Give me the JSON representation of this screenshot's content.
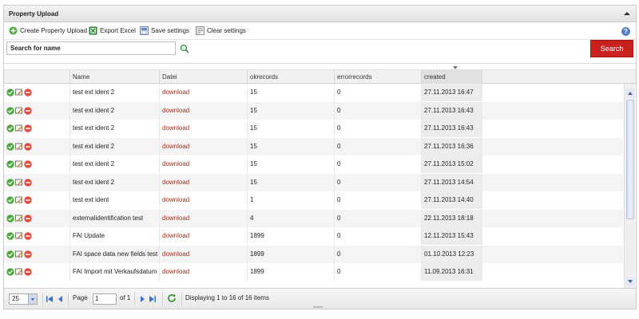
{
  "panel": {
    "title": "Property Upload"
  },
  "toolbar": {
    "create_label": "Create Property Upload",
    "export_label": "Export Excel",
    "save_label": "Save settings",
    "clear_label": "Clear settings"
  },
  "search": {
    "placeholder": "Search for name",
    "value": "Search for name",
    "button_label": "Search"
  },
  "columns": [
    "",
    "Name",
    "Datei",
    "okrecords",
    "errorrecords",
    "created"
  ],
  "rows": [
    {
      "name": "test ext ident 2",
      "file": "download",
      "ok": "15",
      "err": "0",
      "created": "27.11.2013 16:47"
    },
    {
      "name": "test ext ident 2",
      "file": "download",
      "ok": "15",
      "err": "0",
      "created": "27.11.2013 16:43"
    },
    {
      "name": "test ext ident 2",
      "file": "download",
      "ok": "15",
      "err": "0",
      "created": "27.11.2013 16:43"
    },
    {
      "name": "test ext ident 2",
      "file": "download",
      "ok": "15",
      "err": "0",
      "created": "27.11.2013 16:36"
    },
    {
      "name": "test ext ident 2",
      "file": "download",
      "ok": "15",
      "err": "0",
      "created": "27.11.2013 15:02"
    },
    {
      "name": "test ext ident 2",
      "file": "download",
      "ok": "15",
      "err": "0",
      "created": "27.11.2013 14:54"
    },
    {
      "name": "test ext ident",
      "file": "download",
      "ok": "1",
      "err": "0",
      "created": "27.11.2013 14:40"
    },
    {
      "name": "externalidentification test",
      "file": "download",
      "ok": "4",
      "err": "0",
      "created": "22.11.2013 18:18"
    },
    {
      "name": "FAI Update",
      "file": "download",
      "ok": "1899",
      "err": "0",
      "created": "12.11.2013 15:43"
    },
    {
      "name": "FAI space data new fields test",
      "file": "download",
      "ok": "1899",
      "err": "0",
      "created": "01.10.2013 12:23"
    },
    {
      "name": "FAI Import mit Verkaufsdatum Uk",
      "file": "download",
      "ok": "1899",
      "err": "0",
      "created": "11.09.2013 16:31"
    }
  ],
  "pager": {
    "page_size": "25",
    "page_label": "Page",
    "page_value": "1",
    "of_label": "of 1",
    "display_text": "Displaying 1 to 16 of 16 items"
  },
  "colors": {
    "accent": "#c9211e",
    "link": "#a03020"
  }
}
